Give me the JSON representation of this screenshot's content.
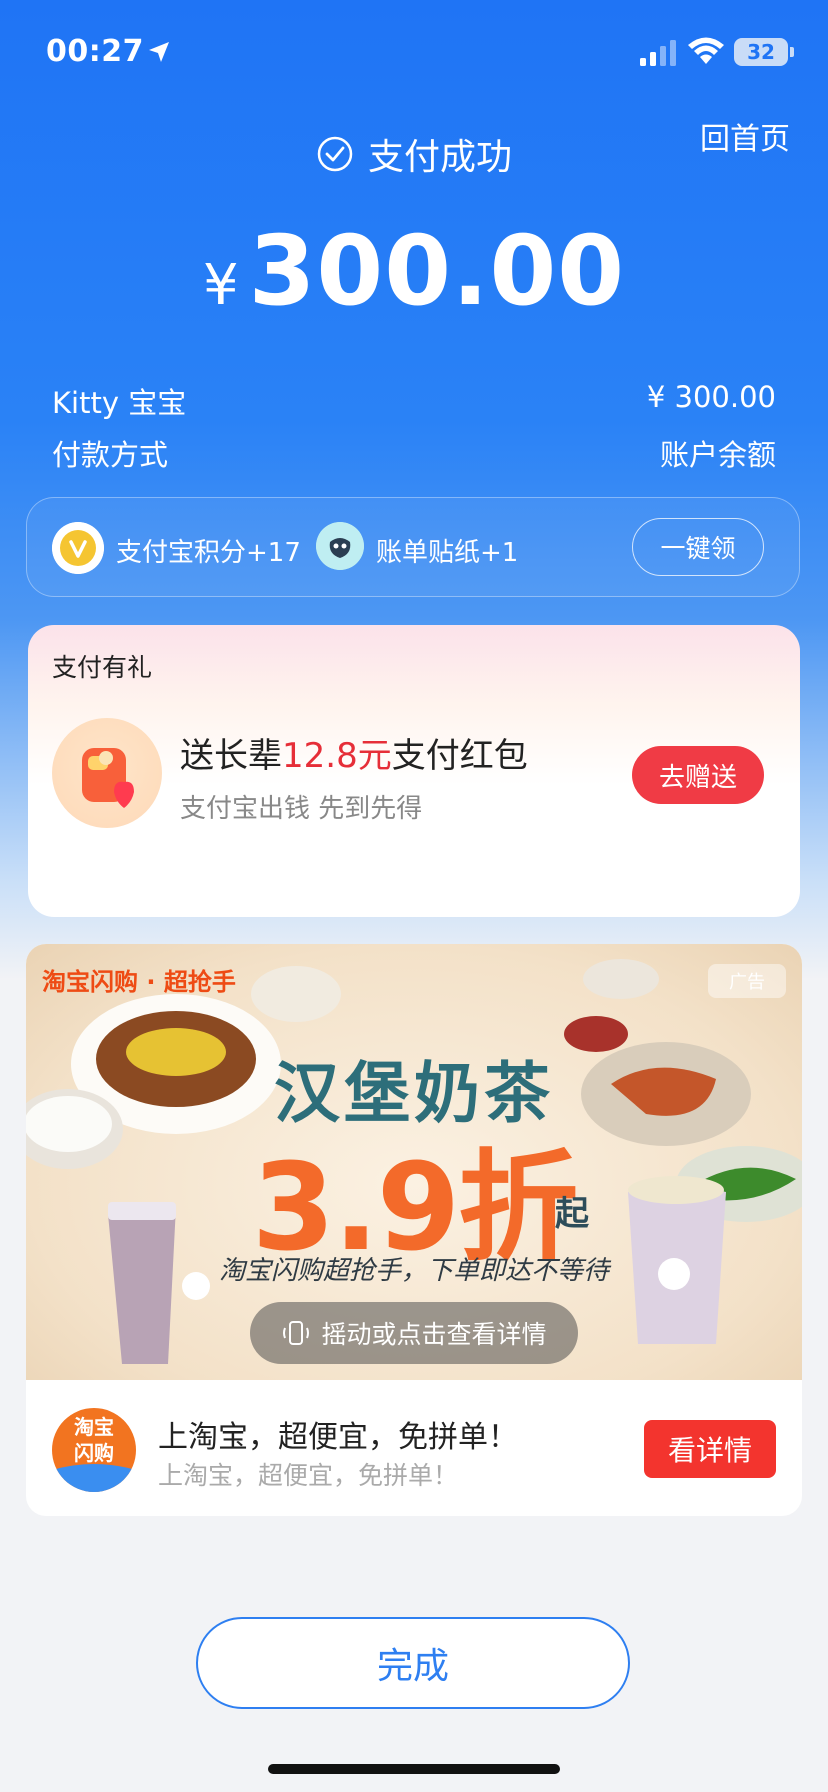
{
  "status_bar": {
    "time": "00:27",
    "battery": "32"
  },
  "header": {
    "home_link": "回首页",
    "status": "支付成功",
    "currency": "¥",
    "amount": "300.00"
  },
  "details": {
    "payee": "Kitty 宝宝",
    "payee_amount": "¥ 300.00",
    "method_label": "付款方式",
    "method_value": "账户余额"
  },
  "rewards": {
    "points": "支付宝积分+17",
    "sticker": "账单贴纸+1",
    "claim_label": "一键领"
  },
  "gift": {
    "title": "支付有礼",
    "main_prefix": "送长辈",
    "main_highlight": "12.8元",
    "main_suffix": "支付红包",
    "sub": "支付宝出钱 先到先得",
    "button": "去赠送"
  },
  "ad": {
    "brand": "淘宝闪购 · 超抢手",
    "badge": "广告",
    "headline1": "汉堡奶茶",
    "headline2": "3.9折",
    "headline_suffix": "起",
    "slogan": "淘宝闪购超抢手，下单即达不等待",
    "shake": "摇动或点击查看详情",
    "app_logo_line1": "淘宝",
    "app_logo_line2": "闪购",
    "title": "上淘宝，超便宜，免拼单！",
    "subtitle": "上淘宝，超便宜，免拼单！",
    "button": "看详情"
  },
  "done_label": "完成",
  "colors": {
    "primary": "#1f74f5",
    "red": "#f03b45",
    "ad_orange": "#f36a2a"
  }
}
